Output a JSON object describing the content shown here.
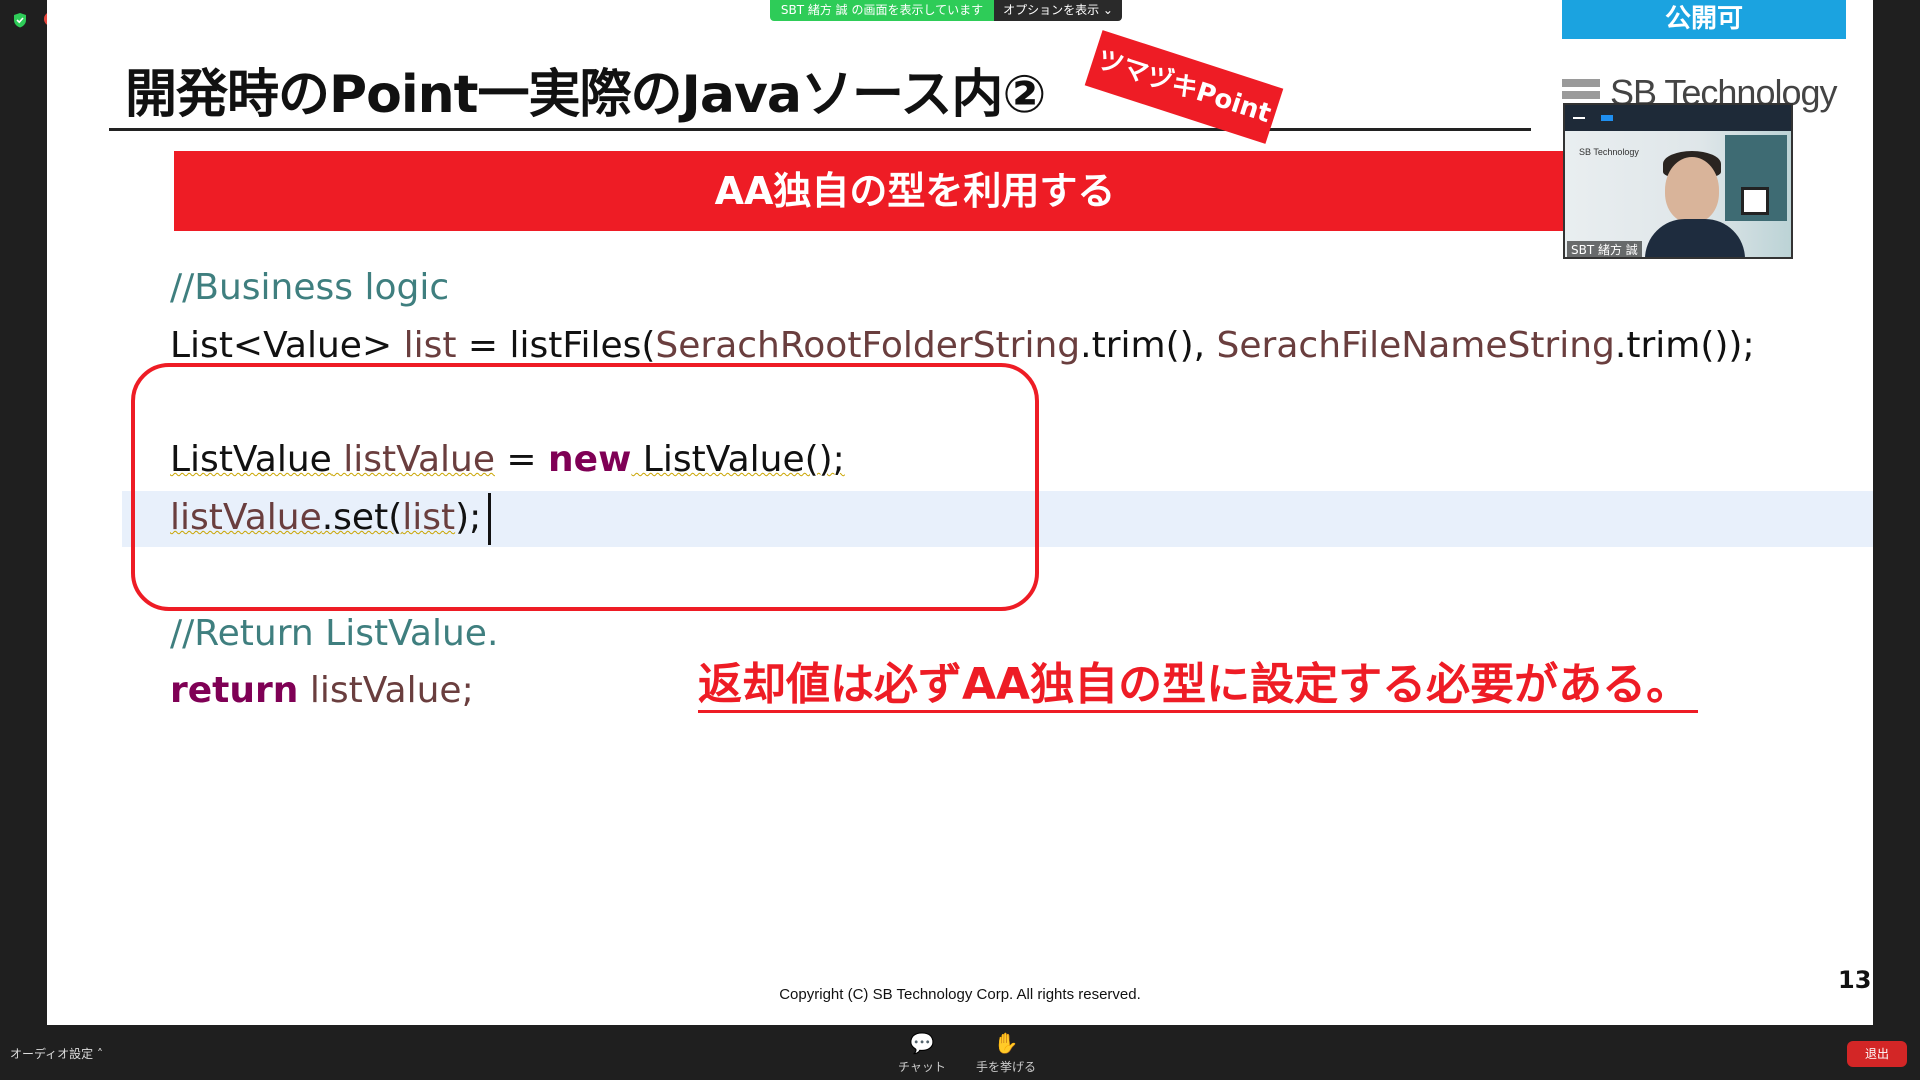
{
  "zoom": {
    "share_banner": "SBT 緒方 誠 の画面を表示しています",
    "options_button": "オプションを表示 ⌄",
    "audio_settings": "オーディオ設定  ˄",
    "chat_label": "チャット",
    "raise_hand_label": "手を挙げる",
    "leave_label": "退出"
  },
  "slide": {
    "title": "開発時のPoint一実際のJavaソース内②",
    "point_badge": "ツマヅキPoint",
    "public_badge": "公開可",
    "company_logo": "SB Technology",
    "section_banner": "AA独自の型を利用する",
    "code": {
      "line1": "//Business logic",
      "line2_a": "List<Value> ",
      "line2_b": "list",
      "line2_c": " = listFiles(",
      "line2_d": "SerachRootFolderString",
      "line2_e": ".trim(), ",
      "line2_f": "SerachFileNameString",
      "line2_g": ".trim());",
      "line3_a": "ListValue",
      "line3_b": " listValue",
      "line3_c": " = ",
      "line3_kw": "new",
      "line3_d": " ListValue();",
      "line4_a": "listValue",
      "line4_b": ".set(",
      "line4_c": "list",
      "line4_d": ");",
      "line5": "//Return ListValue.",
      "line6_kw": "return",
      "line6_a": " listValue;"
    },
    "callout": "返却値は必ずAA独自の型に設定する必要がある。",
    "copyright": "Copyright (C) SB Technology Corp. All rights reserved.",
    "page_number": "13"
  },
  "video": {
    "participant_name": "SBT 緒方 誠",
    "background_logo": "SB Technology"
  }
}
